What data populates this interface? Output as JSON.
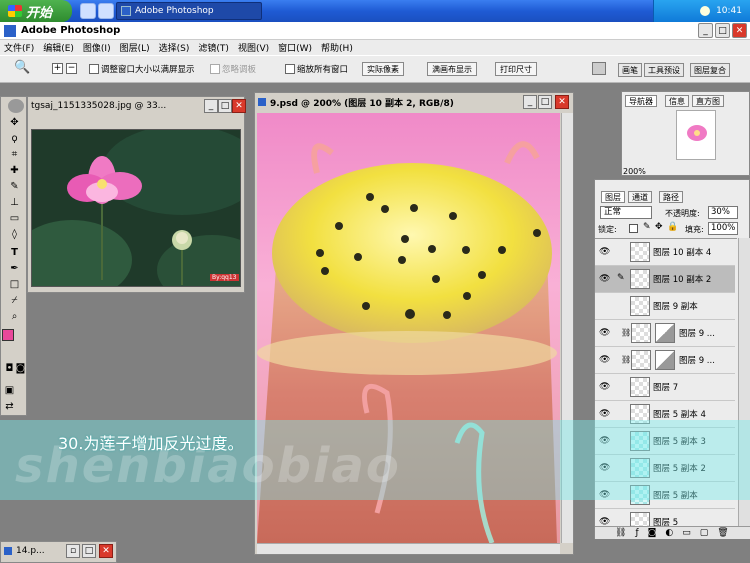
{
  "taskbar": {
    "start_label": "开始",
    "task_label": "Adobe Photoshop",
    "clock": "10:41"
  },
  "app": {
    "title": "Adobe Photoshop"
  },
  "menu": [
    "文件(F)",
    "编辑(E)",
    "图像(I)",
    "图层(L)",
    "选择(S)",
    "滤镜(T)",
    "视图(V)",
    "窗口(W)",
    "帮助(H)"
  ],
  "options": {
    "resize_windows": "调整窗口大小以满屏显示",
    "ignore_palettes": "忽略调板",
    "zoom_all": "缩放所有窗口",
    "actual_pixels": "实际像素",
    "fit_screen": "满画布显示",
    "print_size": "打印尺寸"
  },
  "well_tabs": [
    "画笔",
    "工具预设",
    "图层复合"
  ],
  "doc1": {
    "title": "tgsaj_1151335028.jpg @ 33..."
  },
  "doc2": {
    "title": "9.psd @ 200% (图层 10 副本 2, RGB/8)"
  },
  "doc3": {
    "title": "14.p..."
  },
  "navigator": {
    "tabs": [
      "导航器",
      "信息",
      "直方图"
    ],
    "zoom": "200%"
  },
  "layers": {
    "tabs": [
      "图层",
      "通道",
      "路径"
    ],
    "blend_mode": "正常",
    "opacity_label": "不透明度:",
    "opacity": "30%",
    "lock_label": "锁定:",
    "fill_label": "填充:",
    "fill": "100%",
    "items": [
      {
        "name": "图层 10 副本 4"
      },
      {
        "name": "图层 10 副本 2"
      },
      {
        "name": "图层 9 副本"
      },
      {
        "name": "图层 9 ..."
      },
      {
        "name": "图层 9 ..."
      },
      {
        "name": "图层 7"
      },
      {
        "name": "图层 5 副本 4"
      },
      {
        "name": "图层 5 副本 3"
      },
      {
        "name": "图层 5 副本 2"
      },
      {
        "name": "图层 5 副本"
      },
      {
        "name": "图层 5"
      }
    ]
  },
  "caption": "30.为莲子增加反光过度。",
  "watermark": "shenbiaobiao",
  "watermark_small": "By:qq13"
}
